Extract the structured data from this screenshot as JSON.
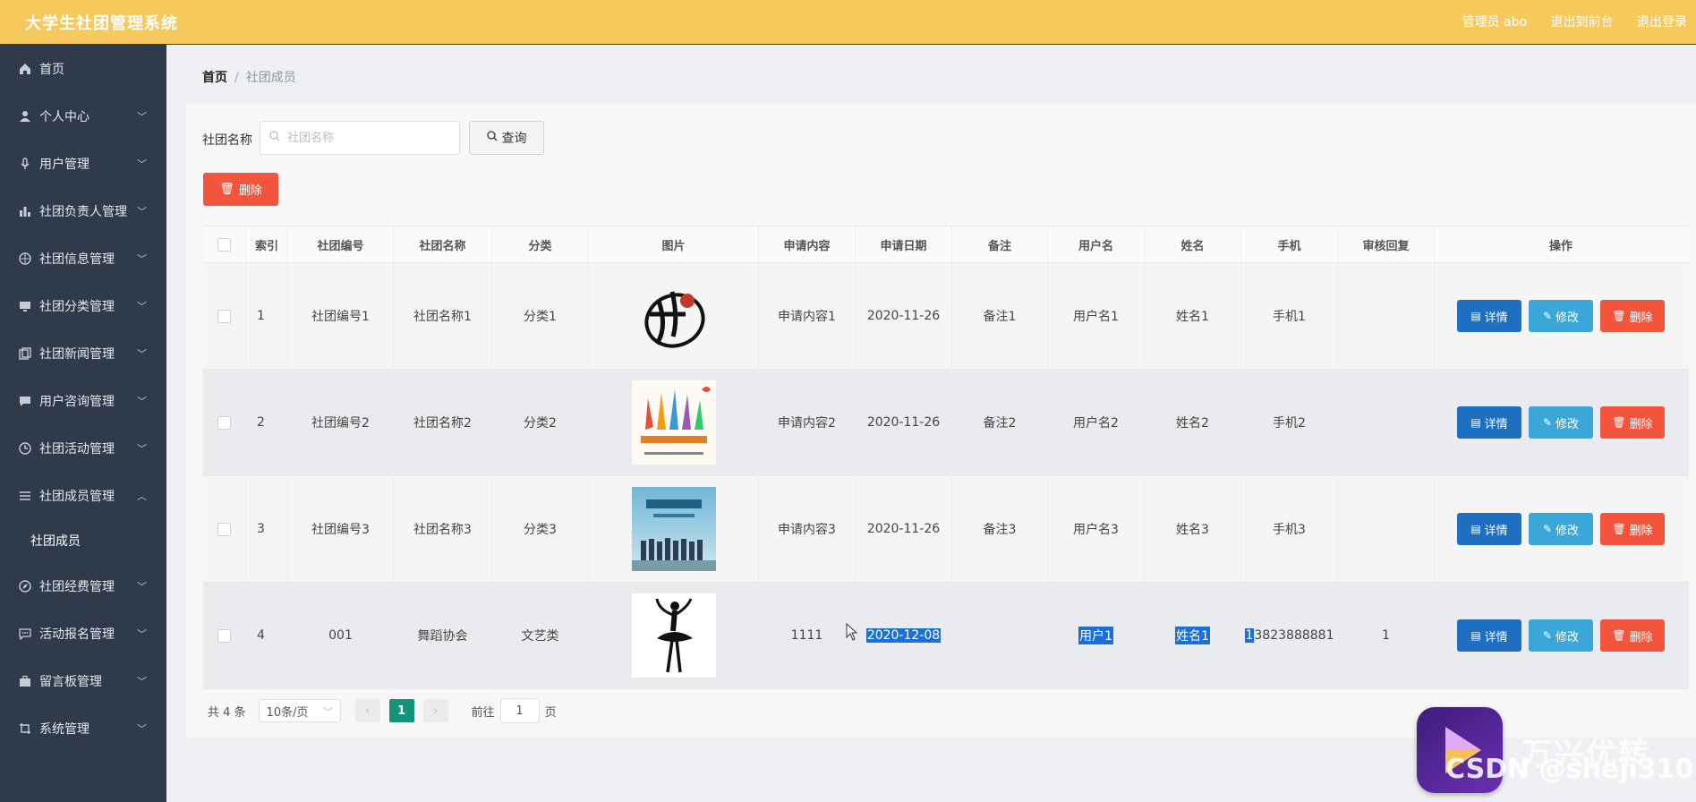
{
  "header": {
    "title": "大学生社团管理系统",
    "admin": "管理员 abo",
    "front": "退出到前台",
    "logout": "退出登录"
  },
  "sidebar": {
    "items": [
      {
        "label": "首页",
        "icon": "home-icon"
      },
      {
        "label": "个人中心",
        "icon": "user-icon"
      },
      {
        "label": "用户管理",
        "icon": "mic-icon"
      },
      {
        "label": "社团负责人管理",
        "icon": "bar-chart-icon"
      },
      {
        "label": "社团信息管理",
        "icon": "compass-icon"
      },
      {
        "label": "社团分类管理",
        "icon": "monitor-icon"
      },
      {
        "label": "社团新闻管理",
        "icon": "copy-icon"
      },
      {
        "label": "用户咨询管理",
        "icon": "chat-icon"
      },
      {
        "label": "社团活动管理",
        "icon": "clock-icon"
      },
      {
        "label": "社团成员管理",
        "icon": "list-icon"
      },
      {
        "label": "社团经费管理",
        "icon": "compass-icon"
      },
      {
        "label": "活动报名管理",
        "icon": "message-icon"
      },
      {
        "label": "留言板管理",
        "icon": "briefcase-icon"
      },
      {
        "label": "系统管理",
        "icon": "crop-icon"
      }
    ],
    "submenu": "社团成员"
  },
  "breadcrumb": {
    "home": "首页",
    "sep": "/",
    "current": "社团成员"
  },
  "search": {
    "label": "社团名称",
    "placeholder": "社团名称",
    "button": "查询"
  },
  "toolbar": {
    "delete": "删除"
  },
  "table": {
    "headers": [
      "索引",
      "社团编号",
      "社团名称",
      "分类",
      "图片",
      "申请内容",
      "申请日期",
      "备注",
      "用户名",
      "姓名",
      "手机",
      "审核回复",
      "操作"
    ],
    "rows": [
      {
        "idx": "1",
        "code": "社团编号1",
        "name": "社团名称1",
        "cat": "分类1",
        "image": "calligraphy-logo",
        "content": "申请内容1",
        "date": "2020-11-26",
        "note": "备注1",
        "user": "用户名1",
        "real": "姓名1",
        "phone": "手机1",
        "reply": ""
      },
      {
        "idx": "2",
        "code": "社团编号2",
        "name": "社团名称2",
        "cat": "分类2",
        "image": "volunteer-hands-poster",
        "content": "申请内容2",
        "date": "2020-11-26",
        "note": "备注2",
        "user": "用户名2",
        "real": "姓名2",
        "phone": "手机2",
        "reply": ""
      },
      {
        "idx": "3",
        "code": "社团编号3",
        "name": "社团名称3",
        "cat": "分类3",
        "image": "club-photo",
        "content": "申请内容3",
        "date": "2020-11-26",
        "note": "备注3",
        "user": "用户名3",
        "real": "姓名3",
        "phone": "手机3",
        "reply": ""
      },
      {
        "idx": "4",
        "code": "001",
        "name": "舞蹈协会",
        "cat": "文艺类",
        "image": "ballet-dancer-silhouette",
        "content": "1111",
        "date": "2020-12-08",
        "note": "",
        "user": "用户1",
        "real": "姓名1",
        "phone_first": "1",
        "phone_rest": "3823888881",
        "reply": "1"
      }
    ],
    "ops": {
      "detail": "详情",
      "edit": "修改",
      "delete": "删除"
    }
  },
  "pagination": {
    "total": "共 4 条",
    "page_size": "10条/页",
    "current_page": "1",
    "goto_label": "前往",
    "goto_value": "1",
    "page_suffix": "页",
    "prev": "‹",
    "next": "›"
  },
  "watermark": {
    "brand": "万兴优转",
    "csdn": "CSDN @sheji310"
  },
  "colors": {
    "header": "#f6c95c",
    "sidebar": "#2f3a4b",
    "danger": "#f2553b",
    "primary": "#1e6fbf",
    "info": "#3ba7d8",
    "pager_active": "#14937a",
    "selection": "#1a6fdb"
  }
}
